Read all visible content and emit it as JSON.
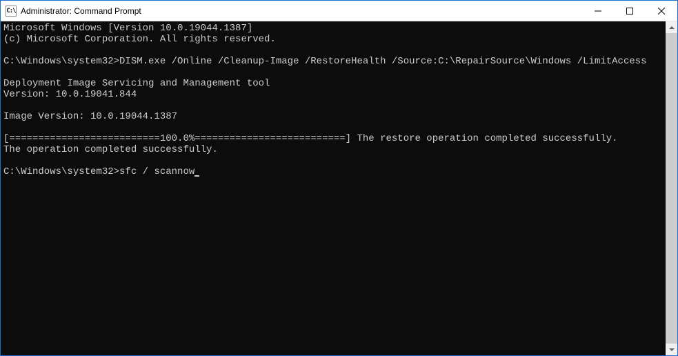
{
  "window": {
    "title": "Administrator: Command Prompt",
    "icon_label": "CMD"
  },
  "console": {
    "lines": [
      "Microsoft Windows [Version 10.0.19044.1387]",
      "(c) Microsoft Corporation. All rights reserved.",
      "",
      "C:\\Windows\\system32>DISM.exe /Online /Cleanup-Image /RestoreHealth /Source:C:\\RepairSource\\Windows /LimitAccess",
      "",
      "Deployment Image Servicing and Management tool",
      "Version: 10.0.19041.844",
      "",
      "Image Version: 10.0.19044.1387",
      "",
      "[==========================100.0%==========================] The restore operation completed successfully.",
      "The operation completed successfully.",
      ""
    ],
    "current_prompt": "C:\\Windows\\system32>",
    "current_input": "sfc / scannow"
  }
}
